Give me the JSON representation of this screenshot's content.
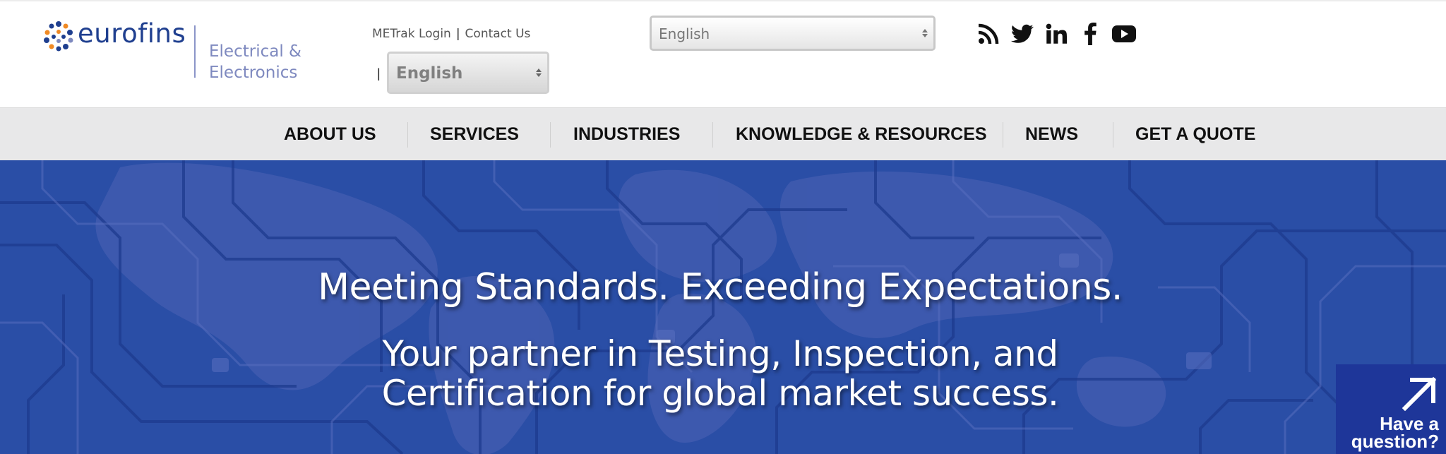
{
  "header": {
    "logo": {
      "name": "eurofins",
      "division_line1": "Electrical &",
      "division_line2": "Electronics",
      "dot_colors": [
        "#f08a24",
        "#1f3f8f",
        "#7e89bf"
      ]
    },
    "top_links": {
      "metrak_login": "METrak Login",
      "separator": "|",
      "contact_us": "Contact Us"
    },
    "small_pipe": "|",
    "language_select_top": {
      "value": "English"
    },
    "language_select_secondary": {
      "value": "English"
    },
    "social_icons": [
      "rss-icon",
      "twitter-icon",
      "linkedin-icon",
      "facebook-icon",
      "youtube-icon"
    ]
  },
  "nav": {
    "items": [
      {
        "label": "ABOUT US"
      },
      {
        "label": "SERVICES"
      },
      {
        "label": "INDUSTRIES"
      },
      {
        "label": "KNOWLEDGE & RESOURCES"
      },
      {
        "label": "NEWS"
      },
      {
        "label": "GET A QUOTE"
      }
    ]
  },
  "hero": {
    "title": "Meeting Standards. Exceeding Expectations.",
    "subtitle_line1": "Your partner in Testing, Inspection, and",
    "subtitle_line2": "Certification for global market success.",
    "background_color": "#2a4ea6"
  },
  "question_widget": {
    "label": "Have a\nquestion?",
    "icon": "arrow-up-right-icon",
    "color": "#1e3699"
  }
}
